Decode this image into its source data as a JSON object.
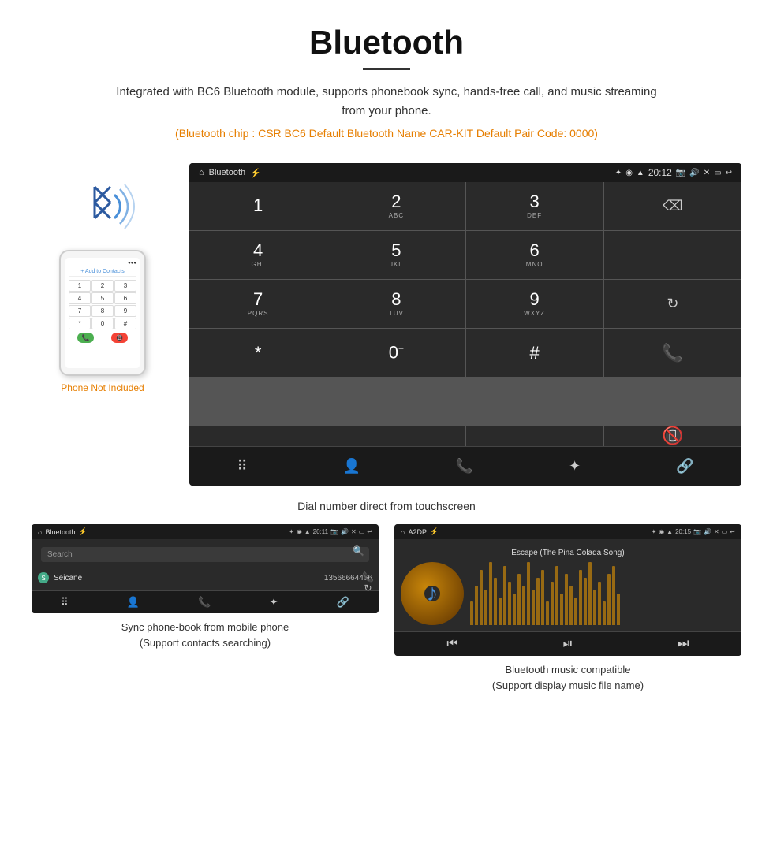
{
  "header": {
    "title": "Bluetooth",
    "description": "Integrated with BC6 Bluetooth module, supports phonebook sync, hands-free call, and music streaming from your phone.",
    "info_text": "(Bluetooth chip : CSR BC6    Default Bluetooth Name CAR-KIT    Default Pair Code: 0000)"
  },
  "car_screen": {
    "status_bar": {
      "label": "Bluetooth",
      "time": "20:12"
    },
    "dialpad": {
      "keys": [
        {
          "number": "1",
          "sub": ""
        },
        {
          "number": "2",
          "sub": "ABC"
        },
        {
          "number": "3",
          "sub": "DEF"
        },
        {
          "number": "4",
          "sub": "GHI"
        },
        {
          "number": "5",
          "sub": "JKL"
        },
        {
          "number": "6",
          "sub": "MNO"
        },
        {
          "number": "7",
          "sub": "PQRS"
        },
        {
          "number": "8",
          "sub": "TUV"
        },
        {
          "number": "9",
          "sub": "WXYZ"
        },
        {
          "number": "*",
          "sub": ""
        },
        {
          "number": "0",
          "sub": "+"
        },
        {
          "number": "#",
          "sub": ""
        }
      ]
    },
    "caption": "Dial number direct from touchscreen"
  },
  "phonebook_screen": {
    "status_bar_label": "Bluetooth",
    "time": "20:11",
    "search_placeholder": "Search",
    "contact": {
      "letter": "S",
      "name": "Seicane",
      "number": "13566664466"
    },
    "caption_line1": "Sync phone-book from mobile phone",
    "caption_line2": "(Support contacts searching)"
  },
  "music_screen": {
    "status_bar_label": "A2DP",
    "time": "20:15",
    "song_title": "Escape (The Pina Colada Song)",
    "caption_line1": "Bluetooth music compatible",
    "caption_line2": "(Support display music file name)"
  },
  "phone_not_included": "Phone Not Included",
  "viz_bars": [
    30,
    50,
    70,
    45,
    80,
    60,
    35,
    75,
    55,
    40,
    65,
    50,
    80,
    45,
    60,
    70,
    30,
    55,
    75,
    40,
    65,
    50,
    35,
    70,
    60,
    80,
    45,
    55,
    30,
    65,
    75,
    40
  ]
}
